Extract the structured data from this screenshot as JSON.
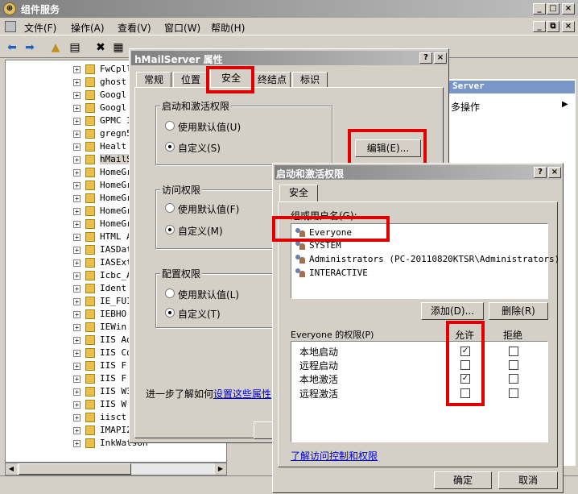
{
  "main_window": {
    "title": "组件服务",
    "menu": [
      "文件(F)",
      "操作(A)",
      "查看(V)",
      "窗口(W)",
      "帮助(H)"
    ],
    "min": "_",
    "max": "□",
    "close": "×",
    "restore": "⧉"
  },
  "tree": {
    "items": [
      "FwCpll",
      "ghost",
      "Googl",
      "Googl",
      "GPMC I",
      "gregn5",
      "Healt",
      "hMailS",
      "HomeGr",
      "HomeGr",
      "HomeGr",
      "HomeGr",
      "HomeGr",
      "HTML A",
      "IASDat",
      "IASExt",
      "Icbc_A",
      "Ident",
      "IE_FUI",
      "IEBHO",
      "IEWin",
      "IIS Ad",
      "IIS Co",
      "IIS F",
      "IIS F",
      "IIS W3",
      "IIS W",
      "iisct",
      "IMAPI2",
      "InkWatson"
    ],
    "selected_index": 7
  },
  "actions_pane": {
    "header": "Server",
    "more": "多操作"
  },
  "props_dialog": {
    "title": "hMailServer 属性",
    "help": "?",
    "close": "×",
    "tabs": [
      "常规",
      "位置",
      "安全",
      "终结点",
      "标识"
    ],
    "active_tab": "安全",
    "launch_group": "启动和激活权限",
    "access_group": "访问权限",
    "config_group": "配置权限",
    "use_default_u": "使用默认值(U)",
    "custom_s": "自定义(S)",
    "use_default_f": "使用默认值(F)",
    "custom_m": "自定义(M)",
    "use_default_l": "使用默认值(L)",
    "custom_t": "自定义(T)",
    "edit_button": "编辑(E)...",
    "learn_more_prefix": "进一步了解如何",
    "learn_more_link": "设置这些属性"
  },
  "launch_dialog": {
    "title": "启动和激活权限",
    "help": "?",
    "close": "×",
    "tab": "安全",
    "group_label": "组或用户名(G):",
    "users": [
      "Everyone",
      "SYSTEM",
      "Administrators (PC-20110820KTSR\\Administrators)",
      "INTERACTIVE"
    ],
    "add_button": "添加(D)...",
    "remove_button": "删除(R)",
    "perm_label": "Everyone 的权限(P)",
    "allow_header": "允许",
    "deny_header": "拒绝",
    "permissions": [
      {
        "name": "本地启动",
        "allow": true,
        "deny": false
      },
      {
        "name": "远程启动",
        "allow": false,
        "deny": false
      },
      {
        "name": "本地激活",
        "allow": true,
        "deny": false
      },
      {
        "name": "远程激活",
        "allow": false,
        "deny": false
      }
    ],
    "link": "了解访问控制和权限",
    "ok": "确定",
    "cancel": "取消"
  }
}
